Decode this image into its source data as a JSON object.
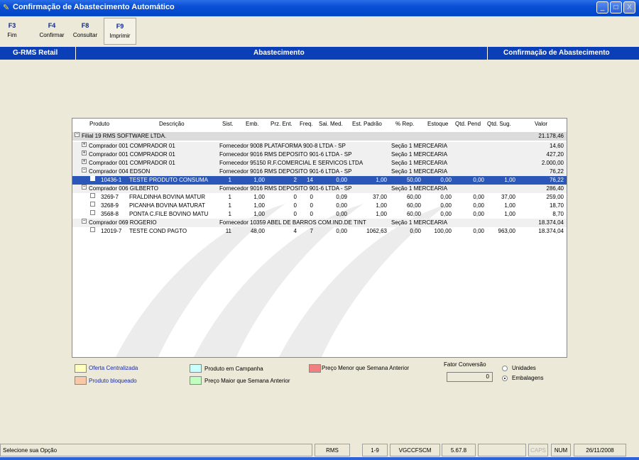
{
  "window": {
    "title": "Confirmação de Abastecimento Automático",
    "controls": [
      "_",
      "□",
      "X"
    ]
  },
  "toolbar": [
    {
      "key": "F3",
      "label": "Fim"
    },
    {
      "key": "F4",
      "label": "Confirmar"
    },
    {
      "key": "F8",
      "label": "Consultar"
    },
    {
      "key": "F9",
      "label": "Imprimir"
    }
  ],
  "header": {
    "left": "G-RMS Retail",
    "center": "Abastecimento",
    "right": "Confirmação de Abastecimento"
  },
  "grid": {
    "columns": [
      "Produto",
      "Descrição",
      "Sist.",
      "Emb.",
      "Prz. Ent.",
      "Freq.",
      "Sai. Med.",
      "Est. Padrão",
      "% Rep.",
      "Estoque",
      "Qtd. Pend",
      "Qtd. Sug.",
      "Valor"
    ],
    "filial": {
      "label": "Filial 19 RMS SOFTWARE LTDA.",
      "valor": "21.178,46"
    },
    "rows": [
      {
        "kind": "comprador",
        "expand": "+",
        "label": "Comprador 001 COMPRADOR 01",
        "fornecedor": "Fornecedor 9008 PLATAFORMA 900-8 LTDA - SP",
        "secao": "Seção 1 MERCEARIA",
        "valor": "14,60"
      },
      {
        "kind": "comprador",
        "expand": "+",
        "label": "Comprador 001 COMPRADOR 01",
        "fornecedor": "Fornecedor 9016 RMS DEPOSITO 901-6 LTDA - SP",
        "secao": "Seção 1 MERCEARIA",
        "valor": "427,20"
      },
      {
        "kind": "comprador",
        "expand": "+",
        "label": "Comprador 001 COMPRADOR 01",
        "fornecedor": "Fornecedor 95150 R.F.COMERCIAL E SERVICOS LTDA",
        "secao": "Seção 1 MERCEARIA",
        "valor": "2.000,00"
      },
      {
        "kind": "comprador",
        "expand": "-",
        "label": "Comprador 004 EDSON",
        "fornecedor": "Fornecedor 9016 RMS DEPOSITO 901-6 LTDA - SP",
        "secao": "Seção 1 MERCEARIA",
        "valor": "76,22"
      },
      {
        "kind": "item",
        "selected": true,
        "produto": "10436-1",
        "descricao": "TESTE PRODUTO CONSUMA",
        "sist": "1",
        "emb": "1,00",
        "prz": "2",
        "freq": "14",
        "saimed": "0,00",
        "estpad": "1,00",
        "rep": "50,00",
        "estoque": "0,00",
        "pend": "0,00",
        "sug": "1,00",
        "valor": "76,22"
      },
      {
        "kind": "comprador",
        "expand": "-",
        "label": "Comprador 006 GILBERTO",
        "fornecedor": "Fornecedor 9016 RMS DEPOSITO 901-6 LTDA - SP",
        "secao": "Seção 1 MERCEARIA",
        "valor": "286,40"
      },
      {
        "kind": "item",
        "produto": "3269-7",
        "descricao": "FRALDINHA BOVINA MATUR",
        "sist": "1",
        "emb": "1,00",
        "prz": "0",
        "freq": "0",
        "saimed": "0,09",
        "estpad": "37,00",
        "rep": "60,00",
        "estoque": "0,00",
        "pend": "0,00",
        "sug": "37,00",
        "valor": "259,00"
      },
      {
        "kind": "item",
        "produto": "3268-9",
        "descricao": "PICANHA BOVINA MATURAT",
        "sist": "1",
        "emb": "1,00",
        "prz": "0",
        "freq": "0",
        "saimed": "0,00",
        "estpad": "1,00",
        "rep": "60,00",
        "estoque": "0,00",
        "pend": "0,00",
        "sug": "1,00",
        "valor": "18,70"
      },
      {
        "kind": "item",
        "produto": "3568-8",
        "descricao": "PONTA C.FILE BOVINO MATU",
        "sist": "1",
        "emb": "1,00",
        "prz": "0",
        "freq": "0",
        "saimed": "0,00",
        "estpad": "1,00",
        "rep": "60,00",
        "estoque": "0,00",
        "pend": "0,00",
        "sug": "1,00",
        "valor": "8,70"
      },
      {
        "kind": "comprador",
        "expand": "-",
        "label": "Comprador 069 ROGERIO",
        "fornecedor": "Fornecedor 10359 ABEL DE BARROS COM.IND.DE TINT",
        "secao": "Seção 1 MERCEARIA",
        "valor": "18.374,04"
      },
      {
        "kind": "item",
        "produto": "12019-7",
        "descricao": "TESTE COND PAGTO",
        "sist": "11",
        "emb": "48,00",
        "prz": "4",
        "freq": "7",
        "saimed": "0,00",
        "estpad": "1062,63",
        "rep": "0,00",
        "estoque": "100,00",
        "pend": "0,00",
        "sug": "963,00",
        "valor": "18.374,04"
      }
    ]
  },
  "legend": {
    "oferta": "Oferta Centralizada",
    "bloqueado": "Produto bloqueado",
    "campanha": "Produto em Campanha",
    "maior": "Preço Maior que Semana Anterior",
    "menor": "Preço Menor que Semana Anterior",
    "fator_label": "Fator Conversão",
    "fator_value": "0",
    "unidades": "Unidades",
    "embalagens": "Embalagens",
    "colors": {
      "oferta": "#ffffc0",
      "bloqueado": "#f8c8a8",
      "campanha": "#c8ffff",
      "maior": "#c0ffc0",
      "menor": "#f08080"
    }
  },
  "status": {
    "message": "Selecione sua Opção",
    "panels": [
      "RMS",
      "1-9",
      "VGCCFSCM",
      "5.67.8",
      "",
      "CAPS",
      "NUM",
      "26/11/2008"
    ]
  }
}
